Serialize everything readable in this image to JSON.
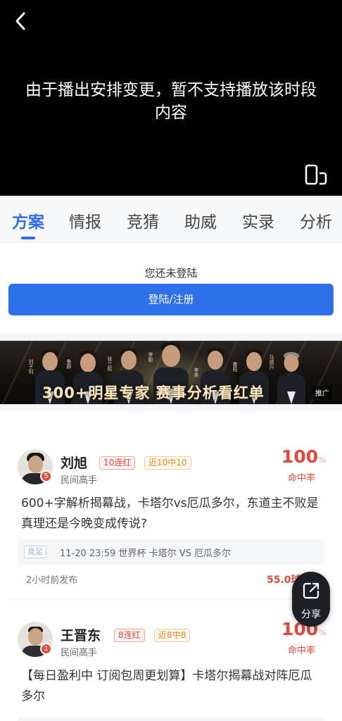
{
  "video": {
    "message": "由于播出安排变更，暂不支持播放该时段内容",
    "back_icon": "chevron-left-icon",
    "screen_icon": "screen-rotate-icon"
  },
  "tabs": [
    {
      "label": "方案",
      "active": true
    },
    {
      "label": "情报",
      "active": false
    },
    {
      "label": "竞猜",
      "active": false
    },
    {
      "label": "助威",
      "active": false
    },
    {
      "label": "实录",
      "active": false
    },
    {
      "label": "分析",
      "active": false
    }
  ],
  "login": {
    "prompt": "您还未登陆",
    "button_label": "登陆/注册"
  },
  "banner": {
    "slogan": "300+明星专家 赛事分析看红单",
    "ad_label": "推广",
    "names": [
      "刘子钊",
      "鲁群",
      "张三松",
      "李毅",
      "李昊",
      "曹阳",
      "王宁",
      "马德兴",
      "刘"
    ],
    "accent_color": "#d4aa5a"
  },
  "posts": [
    {
      "name": "刘旭",
      "level": "5",
      "tags": [
        "10连红",
        "近10中10"
      ],
      "user_title": "民间高手",
      "hit_rate": "100",
      "hit_rate_unit": "%",
      "hit_rate_label": "命中率",
      "content": "600+字解析揭幕战，卡塔尔vs厄瓜多尔，东道主不败是真理还是今晚变成传说?",
      "match_tag": "竞足",
      "match_info": "11-20 23:59 世界杯 卡塔尔 VS 厄瓜多尔",
      "published": "2小时前发布",
      "price": "55.0球币"
    },
    {
      "name": "王晋东",
      "level": "1",
      "tags": [
        "8连红",
        "近8中8"
      ],
      "user_title": "民间高手",
      "hit_rate": "100",
      "hit_rate_unit": "%",
      "hit_rate_label": "命中率",
      "content": "【每日盈利中 订阅包周更划算】卡塔尔揭幕战对阵厄瓜多尔"
    }
  ],
  "share": {
    "label": "分享",
    "icon": "share-icon"
  },
  "colors": {
    "primary": "#2e6ee9",
    "accent_red": "#e1493b",
    "accent_orange": "#ee8c23"
  }
}
